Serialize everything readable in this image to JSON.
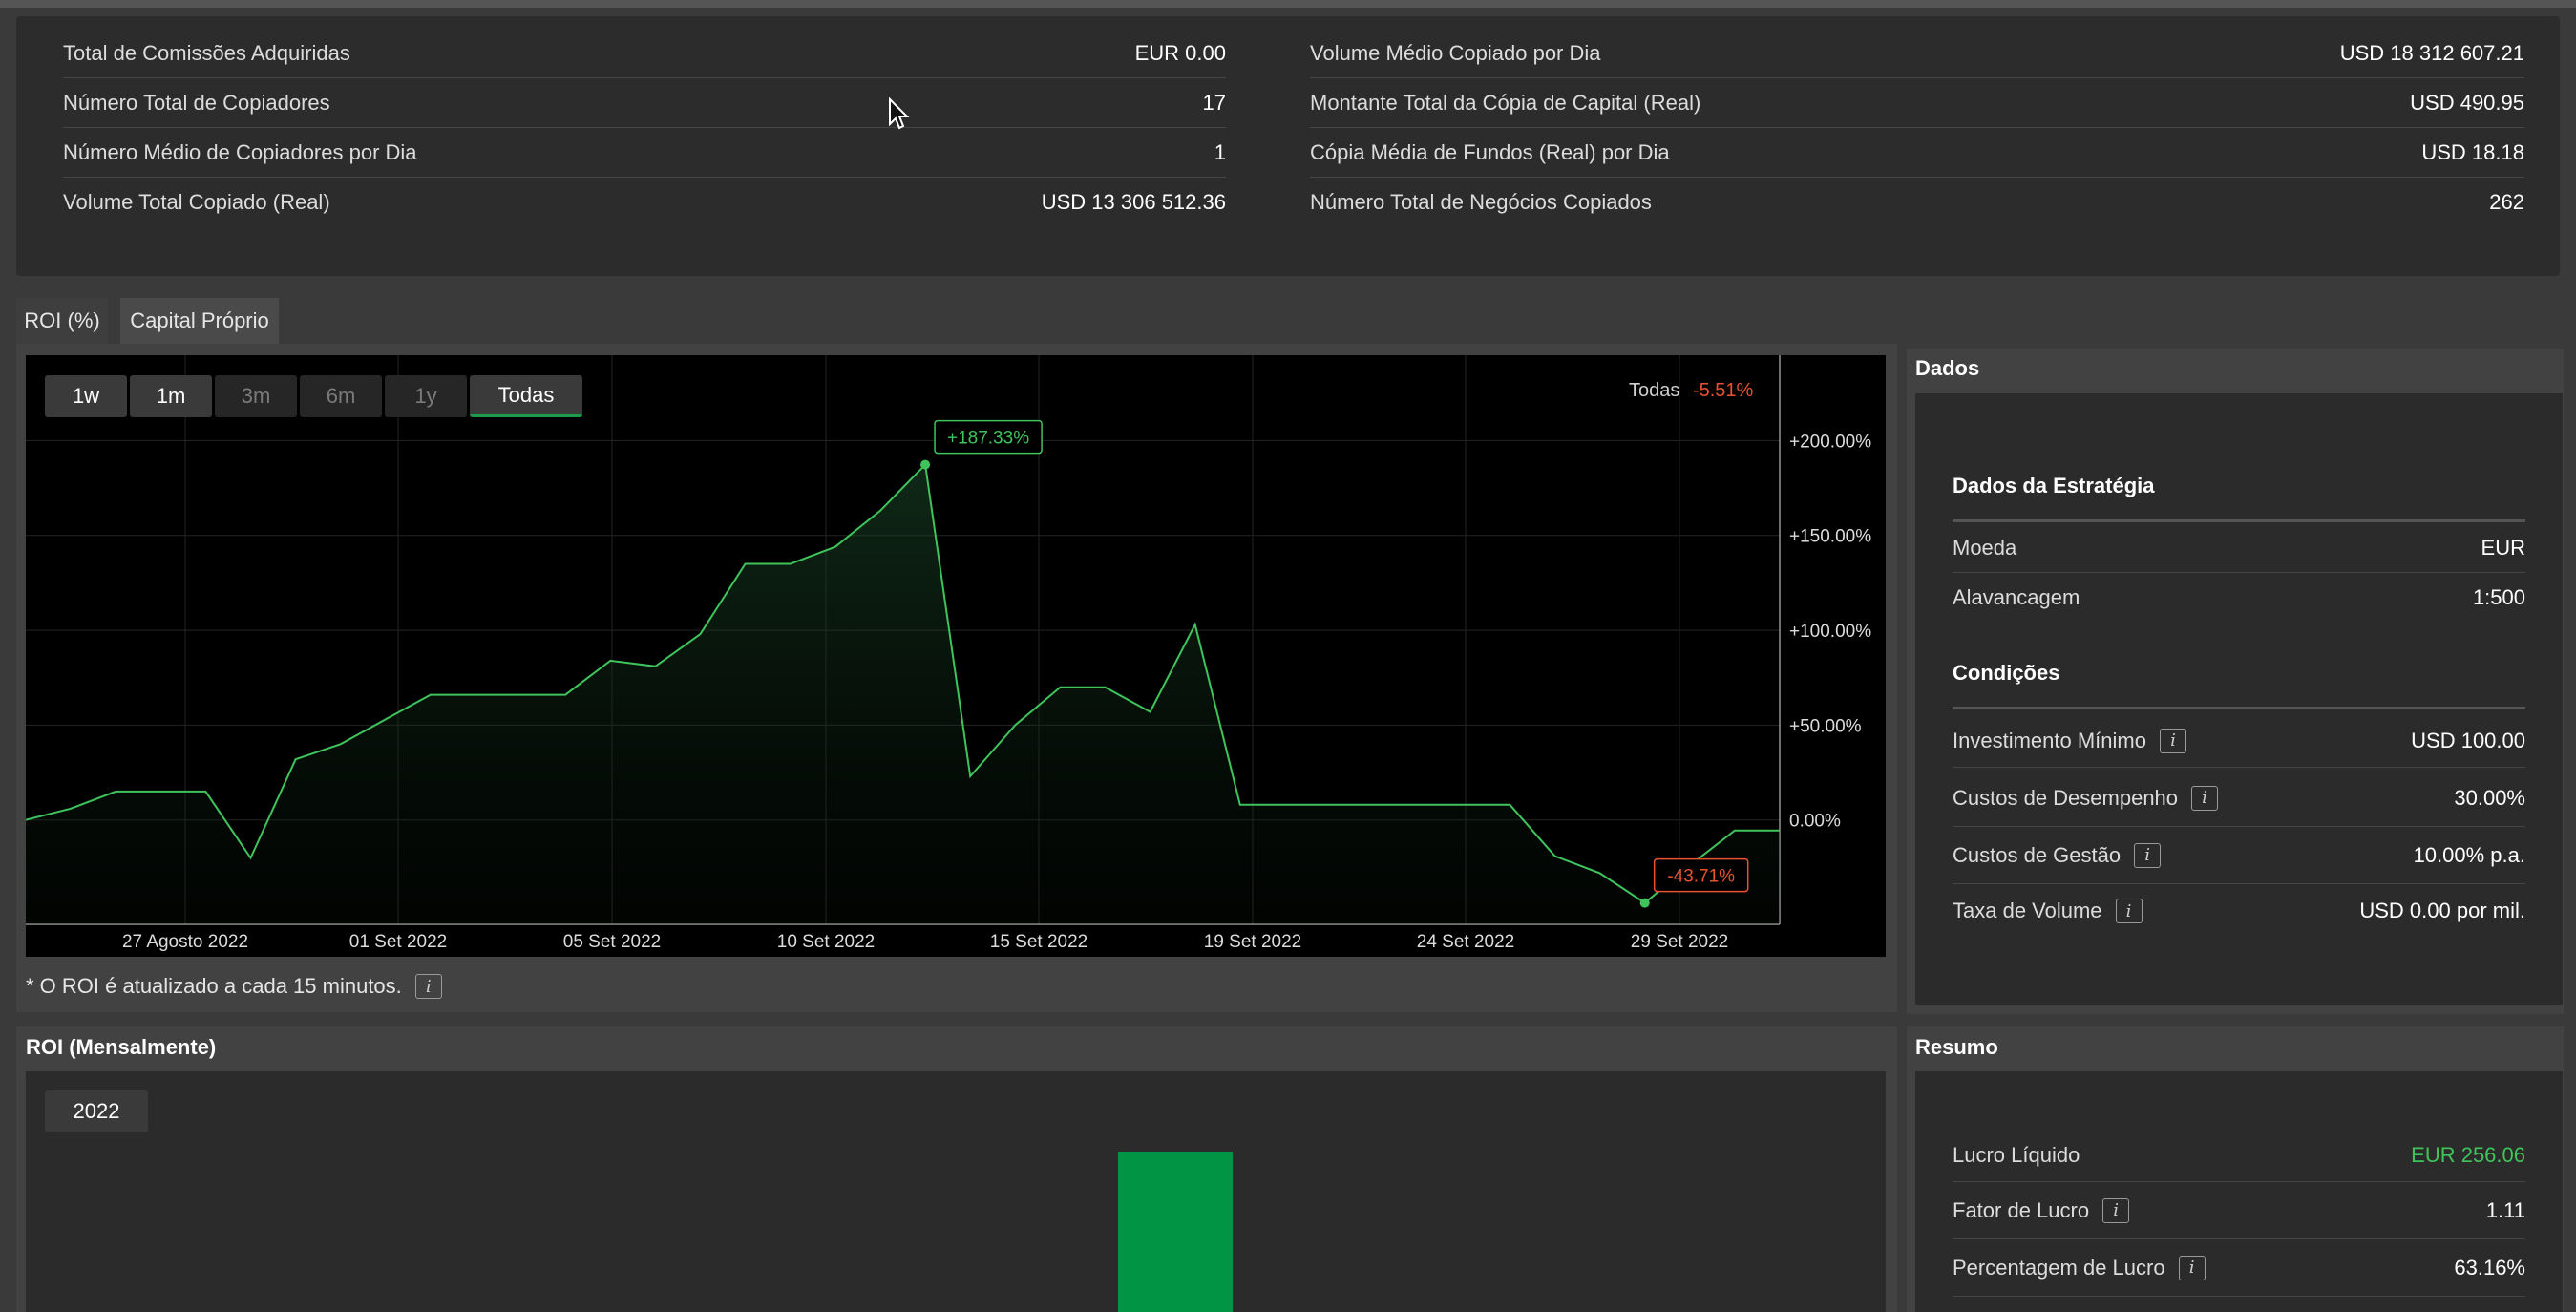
{
  "stats": {
    "left": [
      {
        "label": "Total de Comissões Adquiridas",
        "value": "EUR 0.00"
      },
      {
        "label": "Número Total de Copiadores",
        "value": "17"
      },
      {
        "label": "Número Médio de Copiadores por Dia",
        "value": "1"
      },
      {
        "label": "Volume Total Copiado (Real)",
        "value": "USD 13 306 512.36"
      }
    ],
    "right": [
      {
        "label": "Volume Médio Copiado por Dia",
        "value": "USD 18 312 607.21"
      },
      {
        "label": "Montante Total da Cópia de Capital (Real)",
        "value": "USD 490.95"
      },
      {
        "label": "Cópia Média de Fundos (Real) por Dia",
        "value": "USD 18.18"
      },
      {
        "label": "Número Total de Negócios Copiados",
        "value": "262"
      }
    ]
  },
  "tabs": [
    {
      "label": "ROI (%)",
      "active": true
    },
    {
      "label": "Capital Próprio",
      "active": false
    }
  ],
  "range_buttons": [
    "1w",
    "1m",
    "3m",
    "6m",
    "1y",
    "Todas"
  ],
  "legend": {
    "label": "Todas",
    "value": "-5.51%"
  },
  "chart_data": {
    "type": "area",
    "x_ticks": [
      "27 Agosto 2022",
      "01 Set 2022",
      "05 Set 2022",
      "10 Set 2022",
      "15 Set 2022",
      "19 Set 2022",
      "24 Set 2022",
      "29 Set 2022"
    ],
    "y_ticks": [
      "+200.00%",
      "+150.00%",
      "+100.00%",
      "+50.00%",
      "0.00%"
    ],
    "ylim": [
      -55,
      245
    ],
    "values": [
      0,
      6,
      15,
      15,
      15,
      -20,
      32,
      40,
      53,
      66,
      66,
      66,
      66,
      84,
      81,
      98,
      135,
      135,
      144,
      163,
      187.33,
      23,
      50,
      70,
      70,
      57,
      103,
      8,
      8,
      8,
      8,
      8,
      8,
      8,
      -19,
      -28,
      -43.71,
      -24,
      -5.51,
      -5.51
    ],
    "max_label": "+187.33%",
    "min_label": "-43.71%",
    "line_color": "#3fc45c",
    "negative_color": "#e8532e"
  },
  "roi_note": "* O ROI é atualizado a cada 15 minutos.",
  "dados": {
    "title": "Dados",
    "estrategia_title": "Dados da Estratégia",
    "estrategia": [
      {
        "label": "Moeda",
        "value": "EUR"
      },
      {
        "label": "Alavancagem",
        "value": "1:500"
      }
    ],
    "condicoes_title": "Condições",
    "condicoes": [
      {
        "label": "Investimento Mínimo",
        "value": "USD 100.00"
      },
      {
        "label": "Custos de Desempenho",
        "value": "30.00%"
      },
      {
        "label": "Custos de Gestão",
        "value": "10.00% p.a."
      },
      {
        "label": "Taxa de Volume",
        "value": "USD 0.00 por mil."
      }
    ]
  },
  "roi_monthly": {
    "title": "ROI (Mensalmente)",
    "year": "2022",
    "bar_color": "#009444"
  },
  "resumo": {
    "title": "Resumo",
    "items": [
      {
        "label": "Lucro Líquido",
        "value": "EUR 256.06",
        "positive": true
      },
      {
        "label": "Fator de Lucro",
        "value": "1.11"
      },
      {
        "label": "Percentagem de Lucro",
        "value": "63.16%"
      }
    ]
  },
  "info_glyph": "i"
}
